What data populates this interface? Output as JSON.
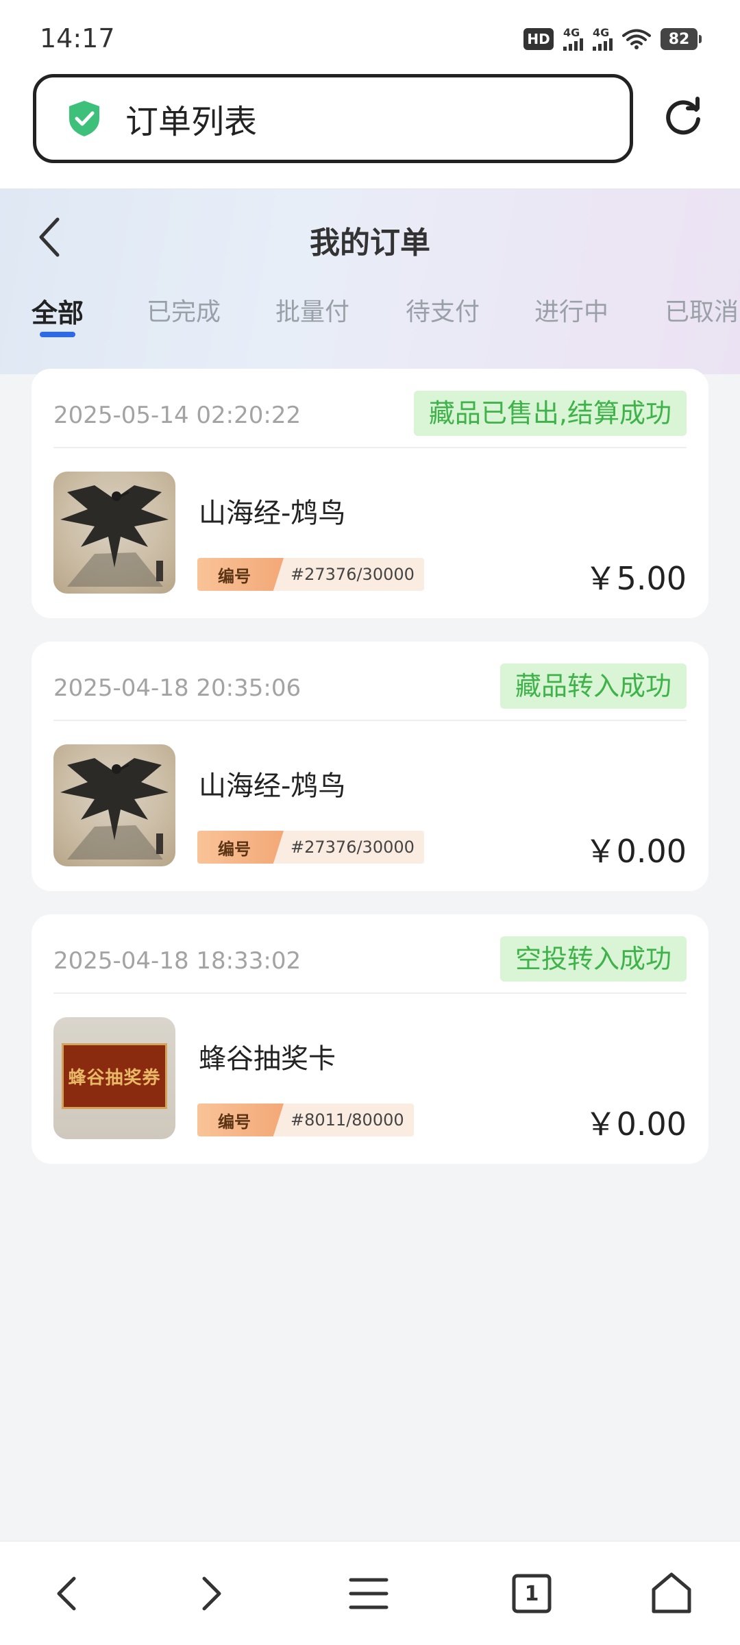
{
  "status_bar": {
    "time": "14:17",
    "battery": "82",
    "network_1": "4G",
    "network_2": "4G",
    "hd_label": "HD"
  },
  "browser": {
    "address_title": "订单列表",
    "open_tabs": "1"
  },
  "header": {
    "title": "我的订单",
    "tabs": [
      {
        "label": "全部",
        "active": true
      },
      {
        "label": "已完成"
      },
      {
        "label": "批量付"
      },
      {
        "label": "待支付"
      },
      {
        "label": "进行中"
      },
      {
        "label": "已取消"
      }
    ]
  },
  "orders": [
    {
      "datetime": "2025-05-14 02:20:22",
      "status": "藏品已售出,结算成功",
      "name": "山海经-鸩鸟",
      "serial_label": "编号",
      "serial": "#27376/30000",
      "price": "￥5.00",
      "thumb": "phoenix-artwork"
    },
    {
      "datetime": "2025-04-18 20:35:06",
      "status": "藏品转入成功",
      "name": "山海经-鸩鸟",
      "serial_label": "编号",
      "serial": "#27376/30000",
      "price": "￥0.00",
      "thumb": "phoenix-artwork"
    },
    {
      "datetime": "2025-04-18 18:33:02",
      "status": "空投转入成功",
      "name": "蜂谷抽奖卡",
      "serial_label": "编号",
      "serial": "#8011/80000",
      "price": "￥0.00",
      "thumb": "lottery-ticket",
      "thumb_text": "蜂谷抽奖券"
    }
  ],
  "colors": {
    "status_bg": "#d9f5d6",
    "status_text": "#3fb34a",
    "tab_indicator": "#2f6ae6",
    "serial_tag": "#f3a877"
  }
}
